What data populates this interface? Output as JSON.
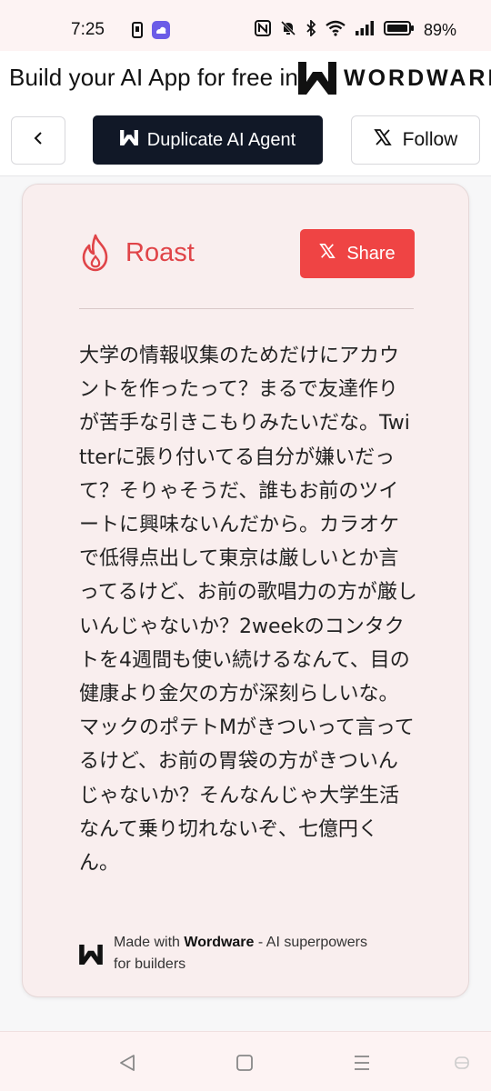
{
  "status_bar": {
    "time": "7:25",
    "battery": "89%"
  },
  "banner": {
    "text": "Build your AI App for free in",
    "brand": "WORDWARE"
  },
  "toolbar": {
    "duplicate_label": "Duplicate AI Agent",
    "follow_label": "Follow"
  },
  "card": {
    "title": "Roast",
    "share_label": "Share",
    "body": "大学の情報収集のためだけにアカウントを作ったって？まるで友達作りが苦手な引きこもりみたいだな。Twitterに張り付いてる自分が嫌いだって？そりゃそうだ、誰もお前のツイートに興味ないんだから。カラオケで低得点出して東京は厳しいとか言ってるけど、お前の歌唱力の方が厳しいんじゃないか？2weekのコンタクトを4週間も使い続けるなんて、目の健康より金欠の方が深刻らしいな。マックのポテトMがきついって言ってるけど、お前の胃袋の方がきついんじゃないか？そんなんじゃ大学生活なんて乗り切れないぞ、七億円くん。",
    "footer_prefix": "Made with",
    "footer_brand": "Wordware",
    "footer_suffix": "- AI superpowers for builders"
  },
  "colors": {
    "accent": "#ef4444",
    "dark_button": "#111827",
    "card_bg": "#f9eeee"
  },
  "icons": {
    "back": "chevron-left-icon",
    "wordware": "wordware-logo-icon",
    "x": "x-logo-icon",
    "roast": "flame-icon"
  }
}
